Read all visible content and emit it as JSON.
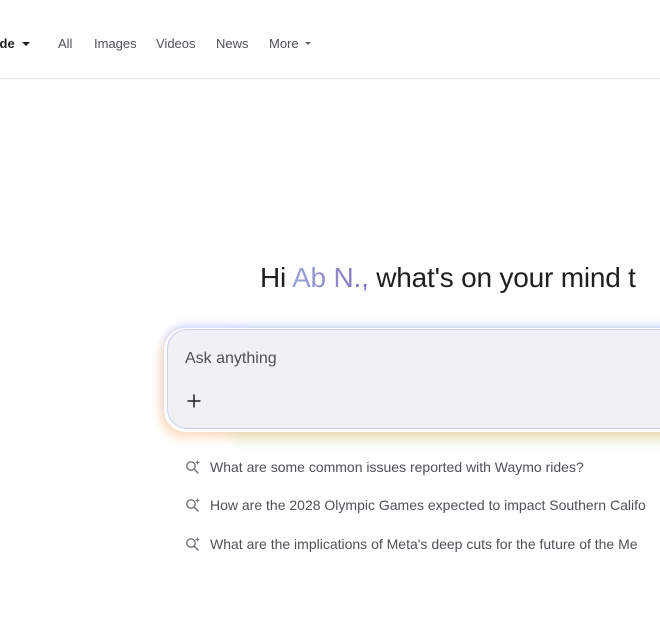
{
  "nav": {
    "mode_label": "AI Mode",
    "mode_label_visible": "lode",
    "items": [
      {
        "label": "All"
      },
      {
        "label": "Images"
      },
      {
        "label": "Videos"
      },
      {
        "label": "News"
      },
      {
        "label": "More"
      }
    ]
  },
  "greeting": {
    "prefix": "Hi ",
    "name": "Ab N.,",
    "suffix": " what's on your mind t"
  },
  "prompt": {
    "placeholder": "Ask anything",
    "plus_label": "+"
  },
  "suggestions": [
    {
      "text": "What are some common issues reported with Waymo rides?",
      "icon": "search-sparkle-icon"
    },
    {
      "text": "How are the 2028 Olympic Games expected to impact Southern Califo",
      "icon": "search-sparkle-icon"
    },
    {
      "text": "What are the implications of Meta's deep cuts for the future of the Me",
      "icon": "search-sparkle-icon"
    }
  ],
  "colors": {
    "accent_name_start": "#9aa6d8",
    "accent_name_end": "#7b6fbf",
    "input_bg": "#f0f1f5",
    "divider": "#e3e3e3"
  }
}
